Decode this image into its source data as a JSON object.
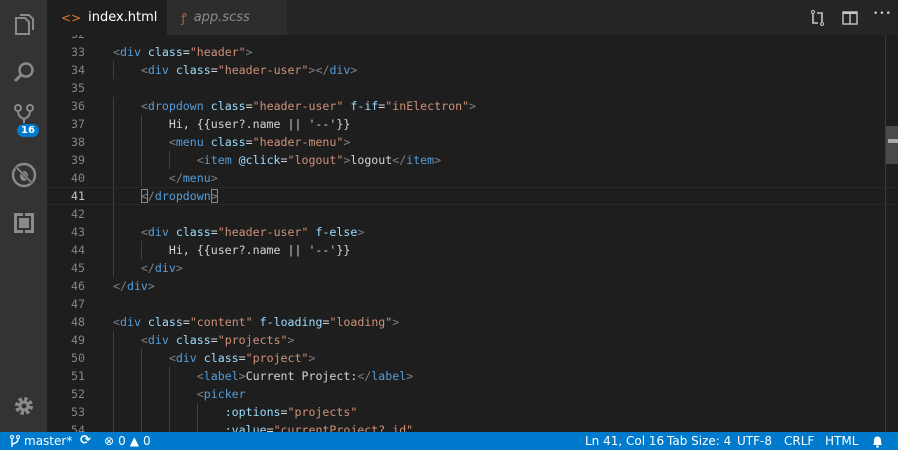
{
  "colors": {
    "accent": "#007acc",
    "activity_bar": "#333333",
    "editor_bg": "#1e1e1e",
    "tag": "#569cd6",
    "attribute": "#9cdcfe",
    "string": "#ce9178",
    "punctuation": "#808080",
    "text": "#d4d4d4"
  },
  "activity_bar": {
    "items": [
      {
        "icon": "files-icon"
      },
      {
        "icon": "search-icon"
      },
      {
        "icon": "source-control-icon",
        "badge": "16"
      },
      {
        "icon": "debug-icon"
      },
      {
        "icon": "extensions-icon"
      }
    ],
    "settings_icon": "gear-icon"
  },
  "tabs": [
    {
      "label": "index.html",
      "icon": "html-icon",
      "active": true,
      "close": "✕"
    },
    {
      "label": "app.scss",
      "icon": "sass-icon",
      "active": false
    }
  ],
  "tab_actions": [
    {
      "icon": "open-changes-icon"
    },
    {
      "icon": "split-editor-icon"
    },
    {
      "icon": "more-icon",
      "glyph": "•••"
    }
  ],
  "editor": {
    "current_line": 41,
    "lines": [
      {
        "n": "32",
        "tokens": []
      },
      {
        "n": "33",
        "tokens": [
          [
            "p",
            "<"
          ],
          [
            "t",
            "div"
          ],
          [
            "x",
            " "
          ],
          [
            "a",
            "class"
          ],
          [
            "x",
            "="
          ],
          [
            "s",
            "\"header\""
          ],
          [
            "p",
            ">"
          ]
        ]
      },
      {
        "n": "34",
        "tokens": [
          [
            "x",
            "    "
          ],
          [
            "p",
            "<"
          ],
          [
            "t",
            "div"
          ],
          [
            "x",
            " "
          ],
          [
            "a",
            "class"
          ],
          [
            "x",
            "="
          ],
          [
            "s",
            "\"header-user\""
          ],
          [
            "p",
            "></"
          ],
          [
            "t",
            "div"
          ],
          [
            "p",
            ">"
          ]
        ]
      },
      {
        "n": "35",
        "tokens": []
      },
      {
        "n": "36",
        "tokens": [
          [
            "x",
            "    "
          ],
          [
            "p",
            "<"
          ],
          [
            "t",
            "dropdown"
          ],
          [
            "x",
            " "
          ],
          [
            "a",
            "class"
          ],
          [
            "x",
            "="
          ],
          [
            "s",
            "\"header-user\""
          ],
          [
            "x",
            " "
          ],
          [
            "a",
            "f-if"
          ],
          [
            "x",
            "="
          ],
          [
            "s",
            "\"inElectron\""
          ],
          [
            "p",
            ">"
          ]
        ]
      },
      {
        "n": "37",
        "tokens": [
          [
            "x",
            "        Hi, {{user?.name || '--'}}"
          ]
        ]
      },
      {
        "n": "38",
        "tokens": [
          [
            "x",
            "        "
          ],
          [
            "p",
            "<"
          ],
          [
            "t",
            "menu"
          ],
          [
            "x",
            " "
          ],
          [
            "a",
            "class"
          ],
          [
            "x",
            "="
          ],
          [
            "s",
            "\"header-menu\""
          ],
          [
            "p",
            ">"
          ]
        ]
      },
      {
        "n": "39",
        "tokens": [
          [
            "x",
            "            "
          ],
          [
            "p",
            "<"
          ],
          [
            "t",
            "item"
          ],
          [
            "x",
            " "
          ],
          [
            "a",
            "@click"
          ],
          [
            "x",
            "="
          ],
          [
            "s",
            "\"logout\""
          ],
          [
            "p",
            ">"
          ],
          [
            "x",
            "logout"
          ],
          [
            "p",
            "</"
          ],
          [
            "t",
            "item"
          ],
          [
            "p",
            ">"
          ]
        ]
      },
      {
        "n": "40",
        "tokens": [
          [
            "x",
            "        "
          ],
          [
            "p",
            "</"
          ],
          [
            "t",
            "menu"
          ],
          [
            "p",
            ">"
          ]
        ]
      },
      {
        "n": "41",
        "tokens": [
          [
            "x",
            "    "
          ],
          [
            "pm",
            "<"
          ],
          [
            "p",
            "/"
          ],
          [
            "t",
            "dropdown"
          ],
          [
            "pm",
            ">"
          ]
        ]
      },
      {
        "n": "42",
        "tokens": []
      },
      {
        "n": "43",
        "tokens": [
          [
            "x",
            "    "
          ],
          [
            "p",
            "<"
          ],
          [
            "t",
            "div"
          ],
          [
            "x",
            " "
          ],
          [
            "a",
            "class"
          ],
          [
            "x",
            "="
          ],
          [
            "s",
            "\"header-user\""
          ],
          [
            "x",
            " "
          ],
          [
            "a",
            "f-else"
          ],
          [
            "p",
            ">"
          ]
        ]
      },
      {
        "n": "44",
        "tokens": [
          [
            "x",
            "        Hi, {{user?.name || '--'}}"
          ]
        ]
      },
      {
        "n": "45",
        "tokens": [
          [
            "x",
            "    "
          ],
          [
            "p",
            "</"
          ],
          [
            "t",
            "div"
          ],
          [
            "p",
            ">"
          ]
        ]
      },
      {
        "n": "46",
        "tokens": [
          [
            "p",
            "</"
          ],
          [
            "t",
            "div"
          ],
          [
            "p",
            ">"
          ]
        ]
      },
      {
        "n": "47",
        "tokens": []
      },
      {
        "n": "48",
        "tokens": [
          [
            "p",
            "<"
          ],
          [
            "t",
            "div"
          ],
          [
            "x",
            " "
          ],
          [
            "a",
            "class"
          ],
          [
            "x",
            "="
          ],
          [
            "s",
            "\"content\""
          ],
          [
            "x",
            " "
          ],
          [
            "a",
            "f-loading"
          ],
          [
            "x",
            "="
          ],
          [
            "s",
            "\"loading\""
          ],
          [
            "p",
            ">"
          ]
        ]
      },
      {
        "n": "49",
        "tokens": [
          [
            "x",
            "    "
          ],
          [
            "p",
            "<"
          ],
          [
            "t",
            "div"
          ],
          [
            "x",
            " "
          ],
          [
            "a",
            "class"
          ],
          [
            "x",
            "="
          ],
          [
            "s",
            "\"projects\""
          ],
          [
            "p",
            ">"
          ]
        ]
      },
      {
        "n": "50",
        "tokens": [
          [
            "x",
            "        "
          ],
          [
            "p",
            "<"
          ],
          [
            "t",
            "div"
          ],
          [
            "x",
            " "
          ],
          [
            "a",
            "class"
          ],
          [
            "x",
            "="
          ],
          [
            "s",
            "\"project\""
          ],
          [
            "p",
            ">"
          ]
        ]
      },
      {
        "n": "51",
        "tokens": [
          [
            "x",
            "            "
          ],
          [
            "p",
            "<"
          ],
          [
            "t",
            "label"
          ],
          [
            "p",
            ">"
          ],
          [
            "x",
            "Current Project:"
          ],
          [
            "p",
            "</"
          ],
          [
            "t",
            "label"
          ],
          [
            "p",
            ">"
          ]
        ]
      },
      {
        "n": "52",
        "tokens": [
          [
            "x",
            "            "
          ],
          [
            "p",
            "<"
          ],
          [
            "t",
            "picker"
          ]
        ]
      },
      {
        "n": "53",
        "tokens": [
          [
            "x",
            "                "
          ],
          [
            "a",
            ":options"
          ],
          [
            "x",
            "="
          ],
          [
            "s",
            "\"projects\""
          ]
        ]
      },
      {
        "n": "54",
        "tokens": [
          [
            "x",
            "                "
          ],
          [
            "a",
            ":value"
          ],
          [
            "x",
            "="
          ],
          [
            "s",
            "\"currentProject?.id\""
          ]
        ]
      }
    ],
    "guides": {
      "34": 1,
      "36": 1,
      "37": 2,
      "38": 2,
      "39": 3,
      "40": 2,
      "41": 1,
      "42": 1,
      "43": 1,
      "44": 2,
      "45": 1,
      "49": 1,
      "50": 2,
      "51": 3,
      "52": 3,
      "53": 4,
      "54": 4
    }
  },
  "status": {
    "branch": "master*",
    "errors": "0",
    "warnings": "0",
    "position": "Ln 41, Col 16",
    "tab_size": "Tab Size: 4",
    "encoding": "UTF-8",
    "eol": "CRLF",
    "language": "HTML"
  }
}
